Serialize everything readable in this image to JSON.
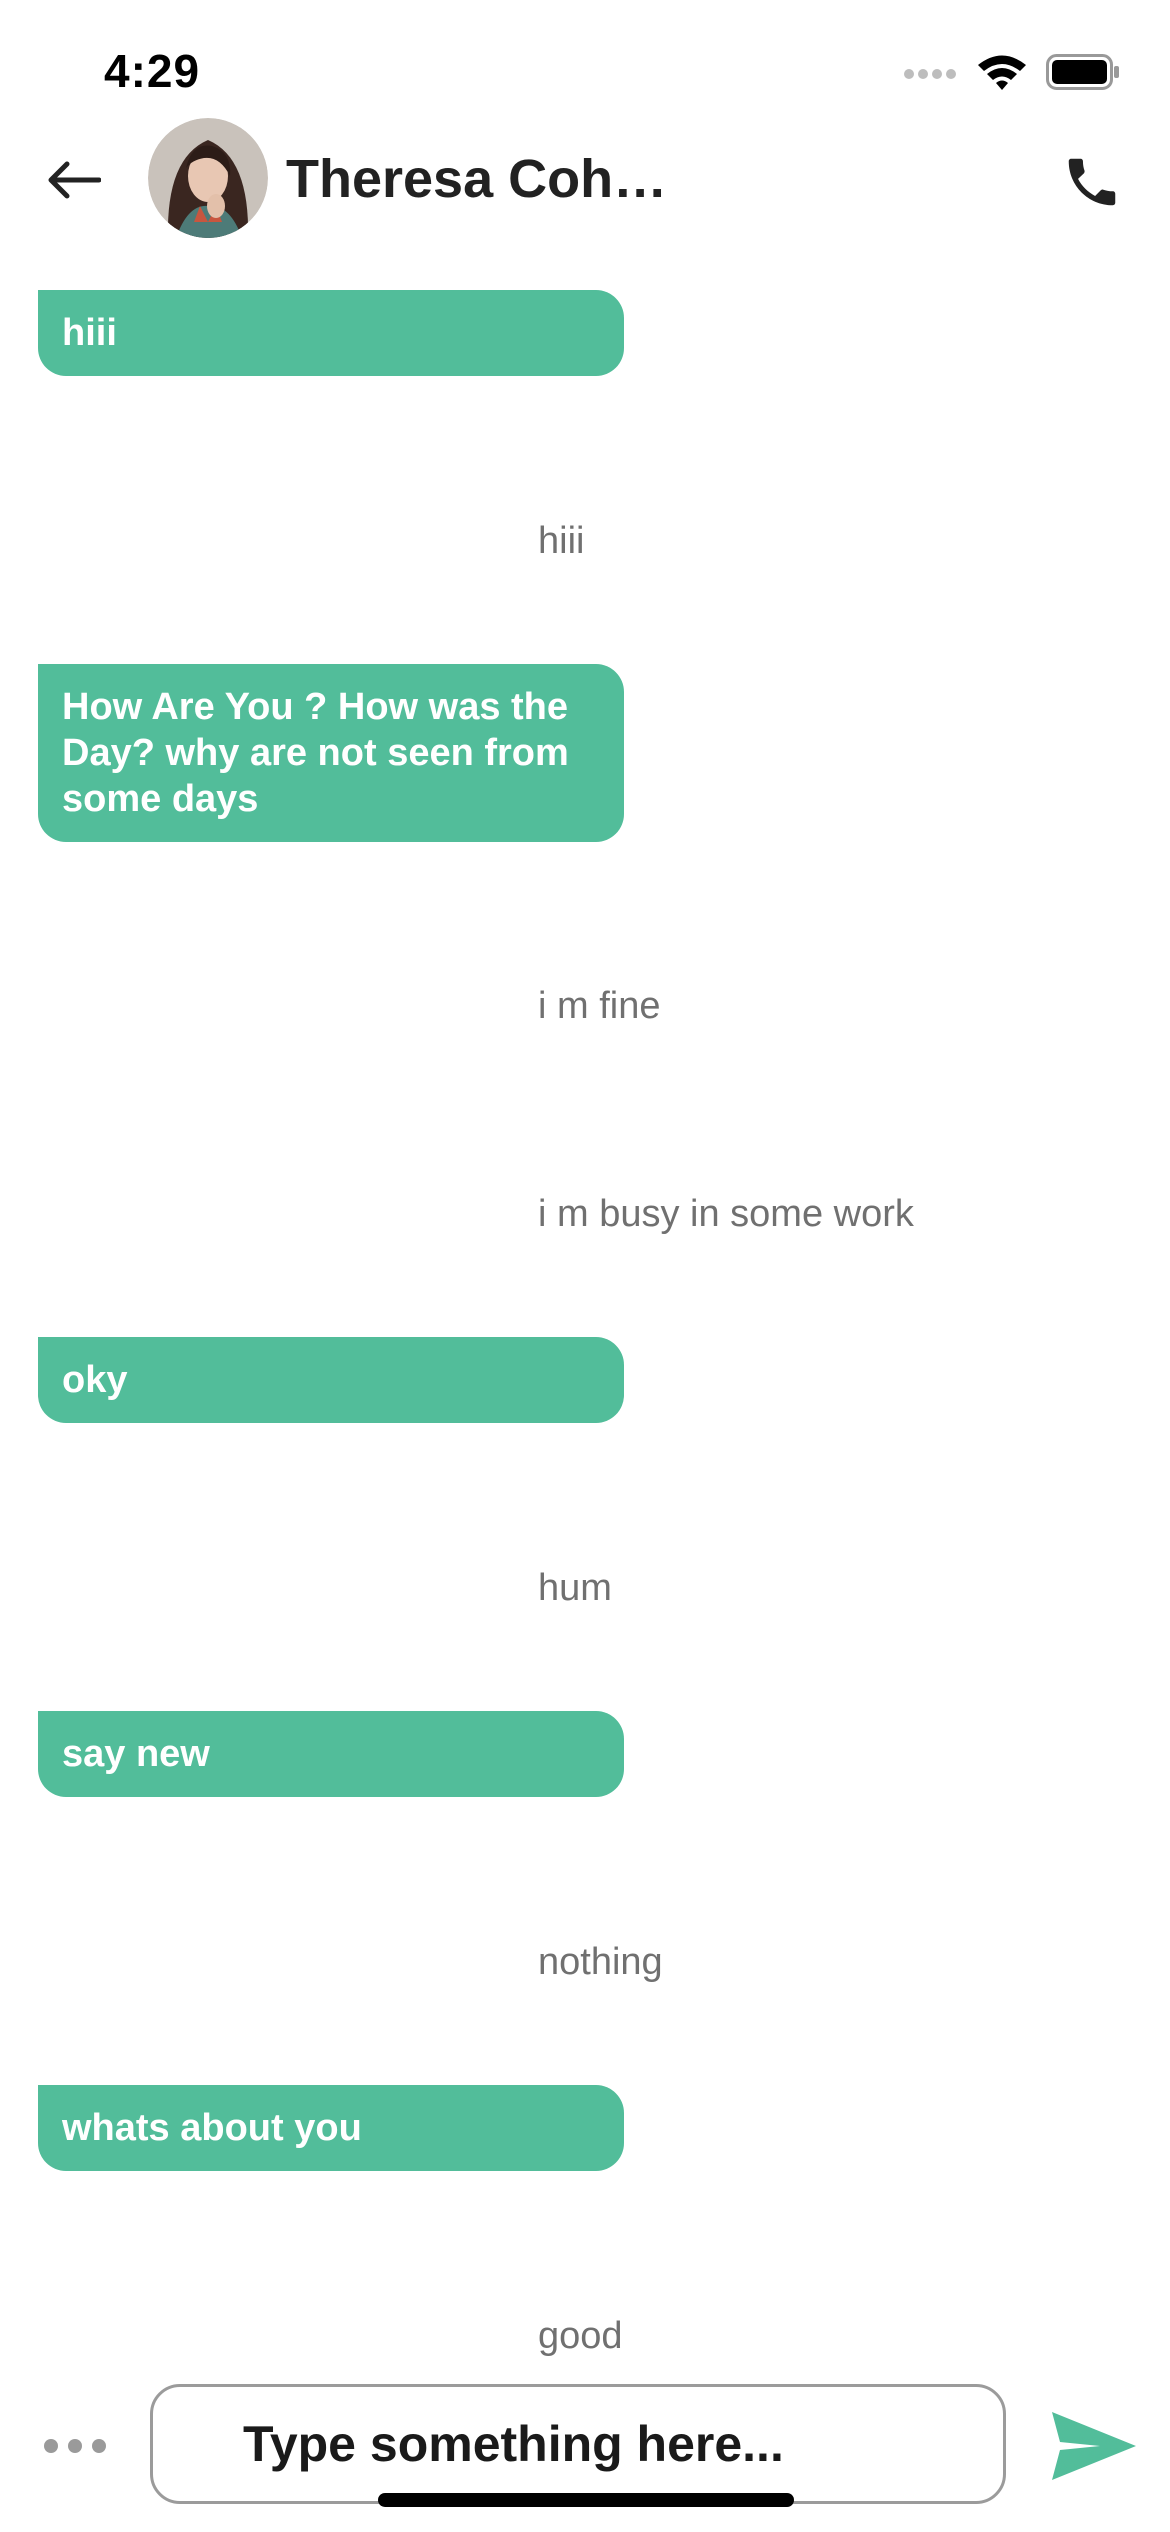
{
  "status_bar": {
    "time": "4:29",
    "icons": [
      "cellular-signal-icon",
      "wifi-icon",
      "battery-icon"
    ]
  },
  "header": {
    "back_icon": "arrow-left-icon",
    "contact_name": "Theresa Cohe...",
    "call_icon": "phone-icon"
  },
  "colors": {
    "incoming_bubble": "#52BD9A",
    "reply_text": "#707070",
    "send_icon": "#52BD9A"
  },
  "messages": [
    {
      "type": "incoming",
      "text": "hiii"
    },
    {
      "type": "outgoing",
      "text": "hiii"
    },
    {
      "type": "incoming",
      "text": "How Are You ? How was the Day? why are not seen from some days"
    },
    {
      "type": "outgoing",
      "text": "i m fine"
    },
    {
      "type": "outgoing",
      "text": "i m busy in some work"
    },
    {
      "type": "incoming",
      "text": "oky"
    },
    {
      "type": "outgoing",
      "text": "hum"
    },
    {
      "type": "incoming",
      "text": "say new"
    },
    {
      "type": "outgoing",
      "text": "nothing"
    },
    {
      "type": "incoming",
      "text": "whats about you"
    },
    {
      "type": "outgoing",
      "text": "good"
    }
  ],
  "composer": {
    "more_icon": "more-dots-icon",
    "placeholder": "Type something here...",
    "send_icon": "send-icon"
  }
}
